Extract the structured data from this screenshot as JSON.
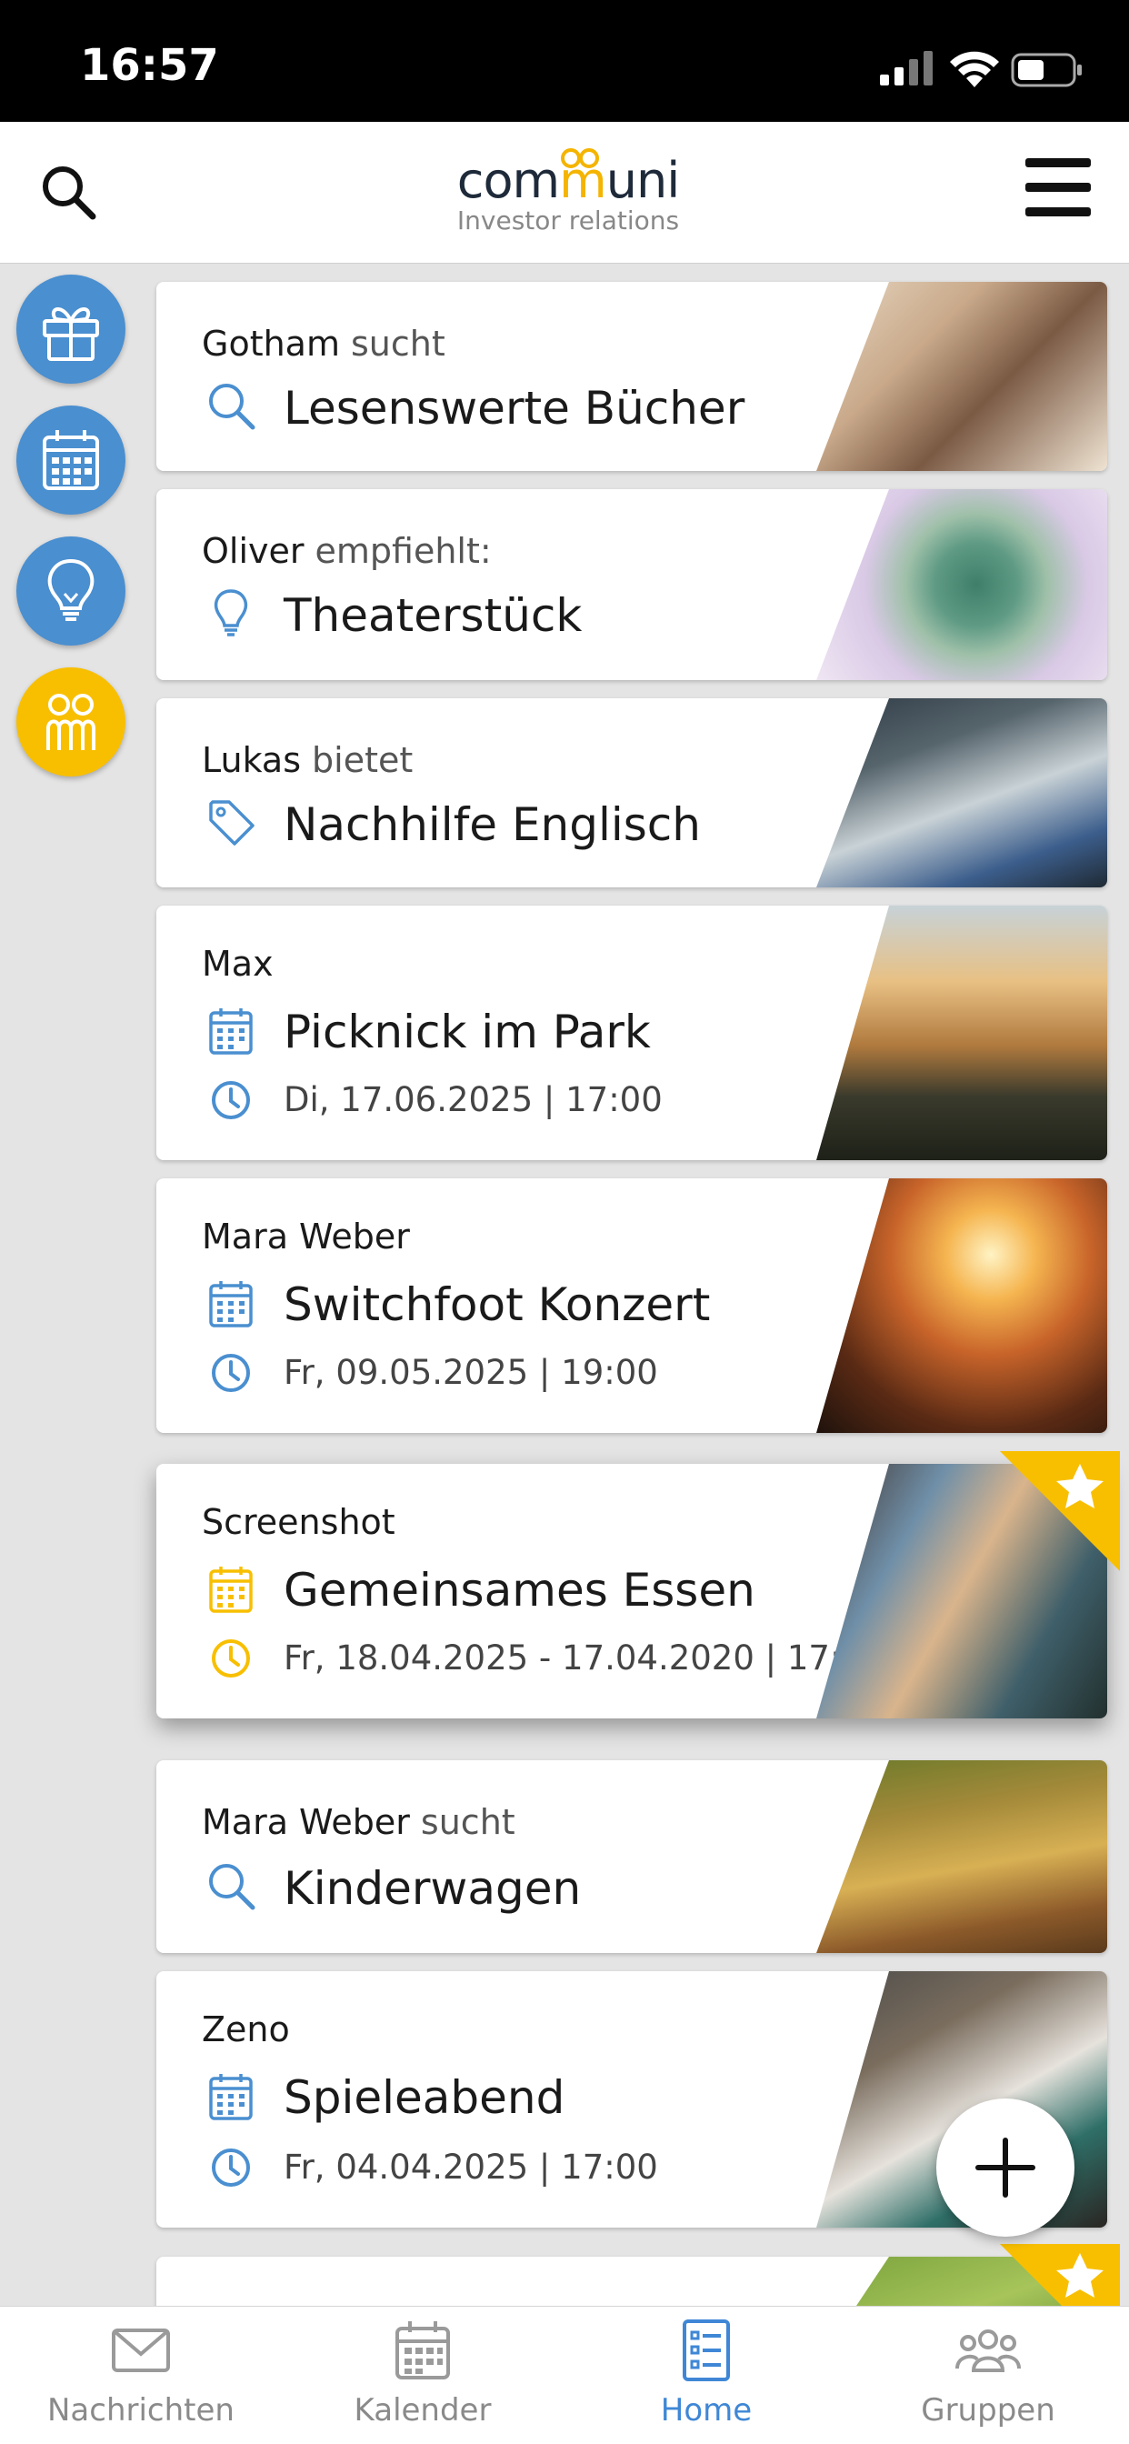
{
  "status_bar": {
    "time": "16:57"
  },
  "header": {
    "logo_main": "com",
    "logo_mm": "m",
    "logo_end": "uni",
    "logo_sub": "Investor relations"
  },
  "side_buttons": [
    {
      "icon": "gift-icon"
    },
    {
      "icon": "calendar-icon"
    },
    {
      "icon": "lightbulb-icon"
    },
    {
      "icon": "communi-logo-icon"
    }
  ],
  "cards": [
    {
      "author": "Gotham",
      "verb": "sucht",
      "icon": "search-icon",
      "title": "Lesenswerte Bücher",
      "date": "",
      "featured": false
    },
    {
      "author": "Oliver",
      "verb": "empfiehlt:",
      "icon": "lightbulb-icon",
      "title": "Theaterstück",
      "date": "",
      "featured": false
    },
    {
      "author": "Lukas",
      "verb": "bietet",
      "icon": "tag-icon",
      "title": "Nachhilfe Englisch",
      "date": "",
      "featured": false
    },
    {
      "author": "Max",
      "verb": "",
      "icon": "calendar-icon",
      "title": "Picknick im Park",
      "date": "Di, 17.06.2025 | 17:00",
      "featured": false
    },
    {
      "author": "Mara Weber",
      "verb": "",
      "icon": "calendar-icon",
      "title": "Switchfoot Konzert",
      "date": "Fr, 09.05.2025 | 19:00",
      "featured": false
    },
    {
      "author": "Screenshot",
      "verb": "",
      "icon": "calendar-icon",
      "title": "Gemeinsames Essen",
      "date": "Fr, 18.04.2025 - 17.04.2020 | 17:00",
      "featured": true
    },
    {
      "author": "Mara Weber",
      "verb": "sucht",
      "icon": "search-icon",
      "title": "Kinderwagen",
      "date": "",
      "featured": false
    },
    {
      "author": "Zeno",
      "verb": "",
      "icon": "calendar-icon",
      "title": "Spieleabend",
      "date": "Fr, 04.04.2025 | 17:00",
      "featured": false
    }
  ],
  "bottom_nav": [
    {
      "label": "Nachrichten",
      "icon": "mail-icon",
      "active": false
    },
    {
      "label": "Kalender",
      "icon": "calendar-icon",
      "active": false
    },
    {
      "label": "Home",
      "icon": "list-icon",
      "active": true
    },
    {
      "label": "Gruppen",
      "icon": "group-icon",
      "active": false
    }
  ],
  "colors": {
    "accent_blue": "#3f87d6",
    "side_blue": "#4a8fd0",
    "featured_yellow": "#f8bf00"
  }
}
